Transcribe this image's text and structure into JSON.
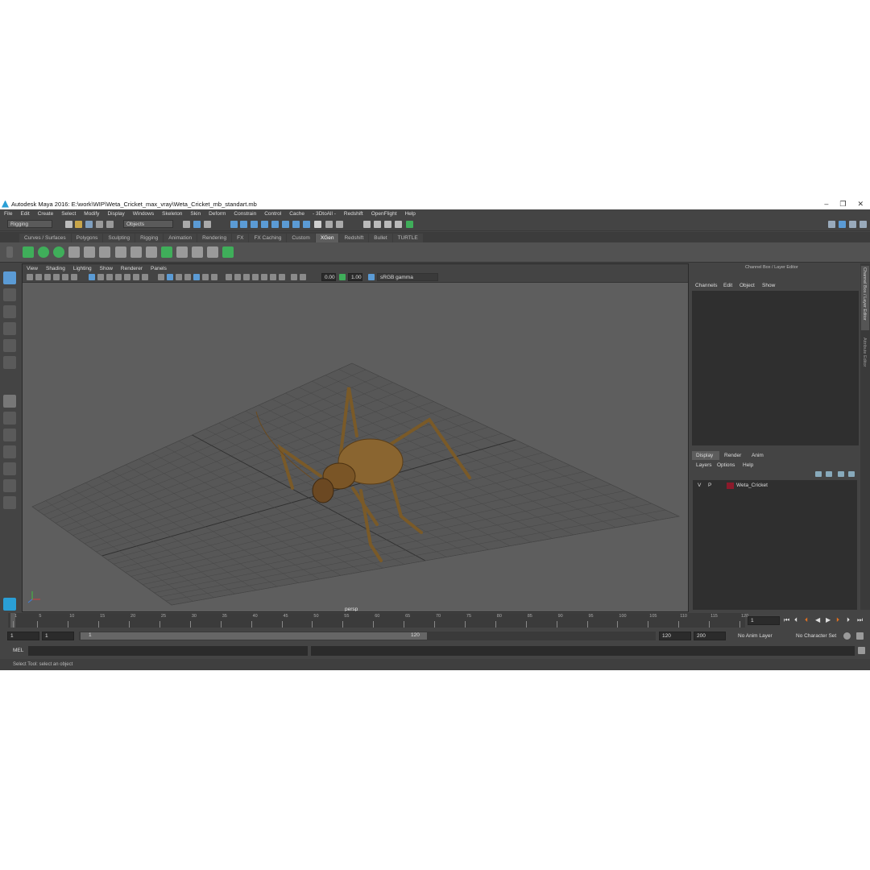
{
  "window": {
    "title": "Autodesk Maya 2016: E:\\work\\WIP\\Weta_Cricket_max_vray\\Weta_Cricket_mb_standart.mb",
    "minimize": "–",
    "maximize": "❐",
    "close": "✕"
  },
  "menubar": [
    "File",
    "Edit",
    "Create",
    "Select",
    "Modify",
    "Display",
    "Windows",
    "Skeleton",
    "Skin",
    "Deform",
    "Constrain",
    "Control",
    "Cache",
    "- 3DtoAll -",
    "Redshift",
    "OpenFlight",
    "Help"
  ],
  "statusline": {
    "menuset": "Rigging",
    "selection_mode": "Objects"
  },
  "shelf_tabs": [
    "Curves / Surfaces",
    "Polygons",
    "Sculpting",
    "Rigging",
    "Animation",
    "Rendering",
    "FX",
    "FX Caching",
    "Custom",
    "XGen",
    "Redshift",
    "Bullet",
    "TURTLE"
  ],
  "active_shelf_tab": "XGen",
  "viewport": {
    "menu": [
      "View",
      "Shading",
      "Lighting",
      "Show",
      "Renderer",
      "Panels"
    ],
    "exposure": "0.00",
    "gamma": "1.00",
    "color_space": "sRGB gamma",
    "camera_label": "persp"
  },
  "channel_box": {
    "title": "Channel Box / Layer Editor",
    "menu": [
      "Channels",
      "Edit",
      "Object",
      "Show"
    ]
  },
  "side_tabs": [
    "Channel Box / Layer Editor",
    "Attribute Editor"
  ],
  "layer_editor": {
    "tabs": [
      "Display",
      "Render",
      "Anim"
    ],
    "active_tab": "Display",
    "menu": [
      "Layers",
      "Options",
      "Help"
    ],
    "layers": [
      {
        "visible": "V",
        "playback": "P",
        "name": "Weta_Cricket",
        "color": "#8b1a2b"
      }
    ]
  },
  "time_slider": {
    "ticks": [
      "1",
      "5",
      "10",
      "15",
      "20",
      "25",
      "30",
      "35",
      "40",
      "45",
      "50",
      "55",
      "60",
      "65",
      "70",
      "75",
      "80",
      "85",
      "90",
      "95",
      "100",
      "105",
      "110",
      "115",
      "120"
    ],
    "current_frame": "1"
  },
  "range_slider": {
    "start": "1",
    "playback_start": "1",
    "range_start_label": "1",
    "range_end_label": "120",
    "playback_end": "120",
    "end": "200",
    "anim_layer": "No Anim Layer",
    "character_set": "No Character Set"
  },
  "command_line": {
    "language": "MEL"
  },
  "help_line": "Select Tool: select an object",
  "colors": {
    "accent_blue": "#5b9bd5",
    "shelf_green": "#3fae5a",
    "active_tab": "#5d5d5d"
  }
}
